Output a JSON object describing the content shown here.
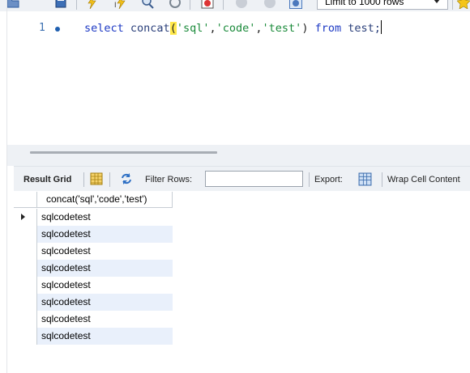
{
  "toolbar": {
    "limit_select": {
      "value": "Limit to 1000 rows"
    },
    "icons": [
      "open-folder-icon",
      "save-icon",
      "execute-icon",
      "execute-current-icon",
      "explain-icon",
      "stop-icon",
      "toggle-error-icon",
      "commit-icon",
      "rollback-icon",
      "autocommit-icon",
      "beautify-icon"
    ]
  },
  "editor": {
    "line_number": "1",
    "code": {
      "kw_select": "select",
      "fn": "concat",
      "open_paren": "(",
      "s1": "'sql'",
      "comma1": ",",
      "s2": "'code'",
      "comma2": ",",
      "s3": "'test'",
      "close_paren": ")",
      "kw_from": "from",
      "table": "test;"
    }
  },
  "result_toolbar": {
    "result_grid_label": "Result Grid",
    "filter_rows_label": "Filter Rows:",
    "filter_value": "",
    "export_label": "Export:",
    "wrap_label": "Wrap Cell Content"
  },
  "grid": {
    "column_header": "concat('sql','code','test')",
    "rows": [
      "sqlcodetest",
      "sqlcodetest",
      "sqlcodetest",
      "sqlcodetest",
      "sqlcodetest",
      "sqlcodetest",
      "sqlcodetest",
      "sqlcodetest"
    ]
  },
  "colors": {
    "keyword": "#1d39c4",
    "string": "#1a8a3a",
    "paren_highlight": "#ffe84a",
    "row_alt": "#e9f0fb",
    "panel_bg": "#eef1f5"
  }
}
